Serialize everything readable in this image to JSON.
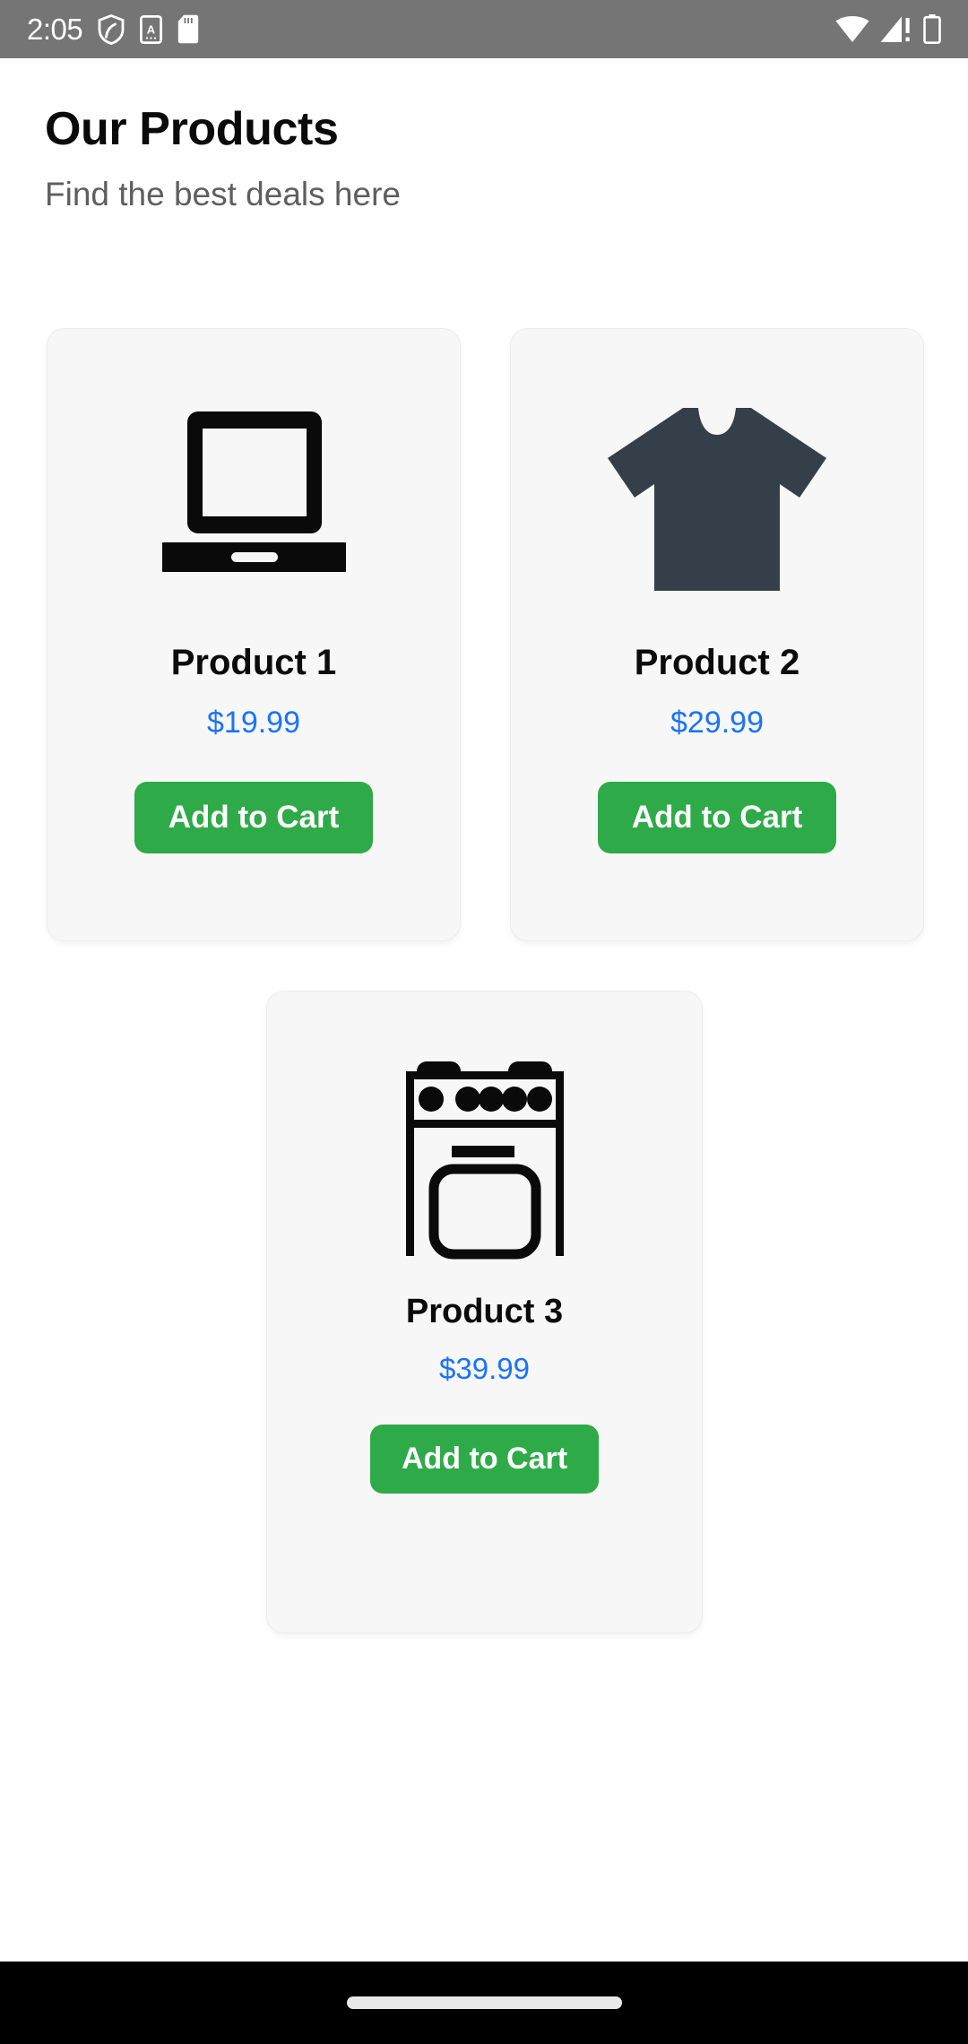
{
  "status_bar": {
    "time": "2:05",
    "left_icons": [
      "shield-icon",
      "a-badge-icon",
      "sd-card-icon"
    ],
    "right_icons": [
      "wifi-icon",
      "cellular-alert-icon",
      "battery-icon"
    ],
    "background_color": "#757575",
    "foreground_color": "#ffffff"
  },
  "header": {
    "title": "Our Products",
    "subtitle": "Find the best deals here"
  },
  "colors": {
    "price": "#1a73ff",
    "button": "#2eab48",
    "card_background": "#f7f7f7",
    "shirt_icon": "#343f49"
  },
  "products": [
    {
      "name": "Product 1",
      "price": "$19.99",
      "button_label": "Add to Cart",
      "icon": "laptop-icon"
    },
    {
      "name": "Product 2",
      "price": "$29.99",
      "button_label": "Add to Cart",
      "icon": "tshirt-icon"
    },
    {
      "name": "Product 3",
      "price": "$39.99",
      "button_label": "Add to Cart",
      "icon": "oven-icon"
    }
  ],
  "nav_bar": {
    "gesture_pill": "home-gesture-pill"
  }
}
